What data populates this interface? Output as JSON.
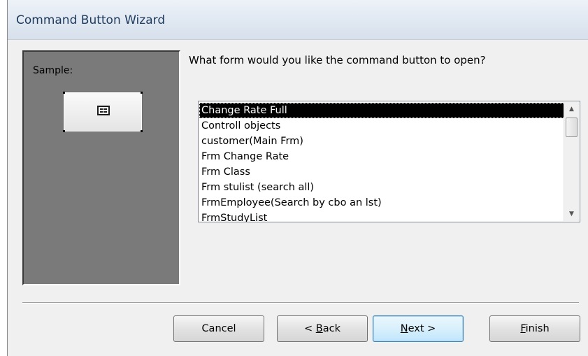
{
  "window": {
    "title": "Command Button Wizard"
  },
  "sample": {
    "label": "Sample:"
  },
  "main": {
    "question": "What form would you like the command button to open?",
    "forms": [
      {
        "label": "Change Rate Full",
        "selected": true
      },
      {
        "label": "Controll objects",
        "selected": false
      },
      {
        "label": "customer(Main Frm)",
        "selected": false
      },
      {
        "label": "Frm Change Rate",
        "selected": false
      },
      {
        "label": "Frm Class",
        "selected": false
      },
      {
        "label": "Frm stulist (search all)",
        "selected": false
      },
      {
        "label": "FrmEmployee(Search  by cbo an lst)",
        "selected": false
      },
      {
        "label": "FrmStudyList",
        "selected": false
      }
    ]
  },
  "buttons": {
    "cancel": "Cancel",
    "back_prefix": "< ",
    "back_accel": "B",
    "back_rest": "ack",
    "next_accel": "N",
    "next_rest": "ext >",
    "finish_accel": "F",
    "finish_rest": "inish"
  },
  "icons": {
    "sample_button_icon": "form-icon",
    "scroll_up": "arrow-up-icon",
    "scroll_down": "arrow-down-icon"
  }
}
